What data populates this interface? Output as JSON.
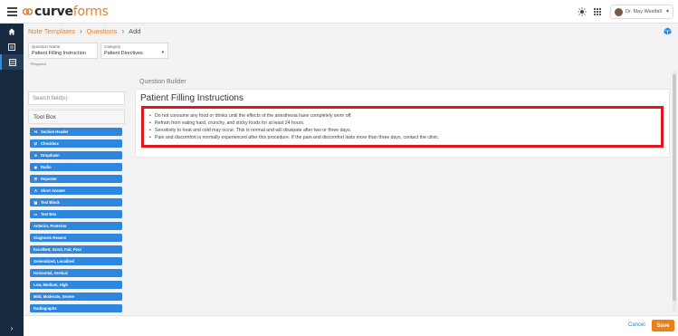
{
  "header": {
    "logo_curve": "curve",
    "logo_forms": "forms",
    "user_name": "Dr. May Westfall"
  },
  "breadcrumb": {
    "items": [
      "Note Templates",
      "Questions",
      "Add"
    ]
  },
  "form": {
    "question_name_label": "Question Name",
    "question_name_value": "Patient Filling Instruction",
    "category_label": "Category",
    "category_value": "Patient Directives",
    "required_note": "*Required"
  },
  "toolbox": {
    "search_placeholder": "Search field(s)",
    "title": "Tool Box",
    "items": [
      {
        "label": "Section Header",
        "icon": "H"
      },
      {
        "label": "Checkbox",
        "icon": "☑"
      },
      {
        "label": "Dropdown",
        "icon": "⊙"
      },
      {
        "label": "Radio",
        "icon": "◉"
      },
      {
        "label": "Repeater",
        "icon": "☰"
      },
      {
        "label": "Short Answer",
        "icon": "A"
      },
      {
        "label": "Text Block",
        "icon": "▤"
      },
      {
        "label": "Text Box",
        "icon": "▭"
      },
      {
        "label": "Anterior, Posterior",
        "icon": ""
      },
      {
        "label": "Diagnosis Reason",
        "icon": ""
      },
      {
        "label": "Excellent, Good, Fair, Poor",
        "icon": ""
      },
      {
        "label": "Generalized, Localized",
        "icon": ""
      },
      {
        "label": "Horizontal, Vertical",
        "icon": ""
      },
      {
        "label": "Low, Medium, High",
        "icon": ""
      },
      {
        "label": "Mild, Moderate, Severe",
        "icon": ""
      },
      {
        "label": "Radiographs",
        "icon": ""
      }
    ]
  },
  "builder": {
    "section_title": "Question Builder",
    "heading": "Patient Filling Instructions",
    "bullets": [
      "Do not consume any food or drinks until the effects of the anesthesia have completely worn off.",
      "Refrain from eating hard, crunchy, and sticky foods for at least 24 hours.",
      "Sensitivity to heat and cold may occur. This is normal and will dissipate after two or three days.",
      "Pain and discomfort is normally experienced after this procedure. If the pain and discomfort lasts more than three days, contact the clinic."
    ]
  },
  "footer": {
    "cancel_label": "Cancel",
    "save_label": "Save"
  },
  "colors": {
    "accent": "#e8812f",
    "primary": "#2e86de",
    "sidebar": "#17293e",
    "highlight": "#e3141b"
  }
}
